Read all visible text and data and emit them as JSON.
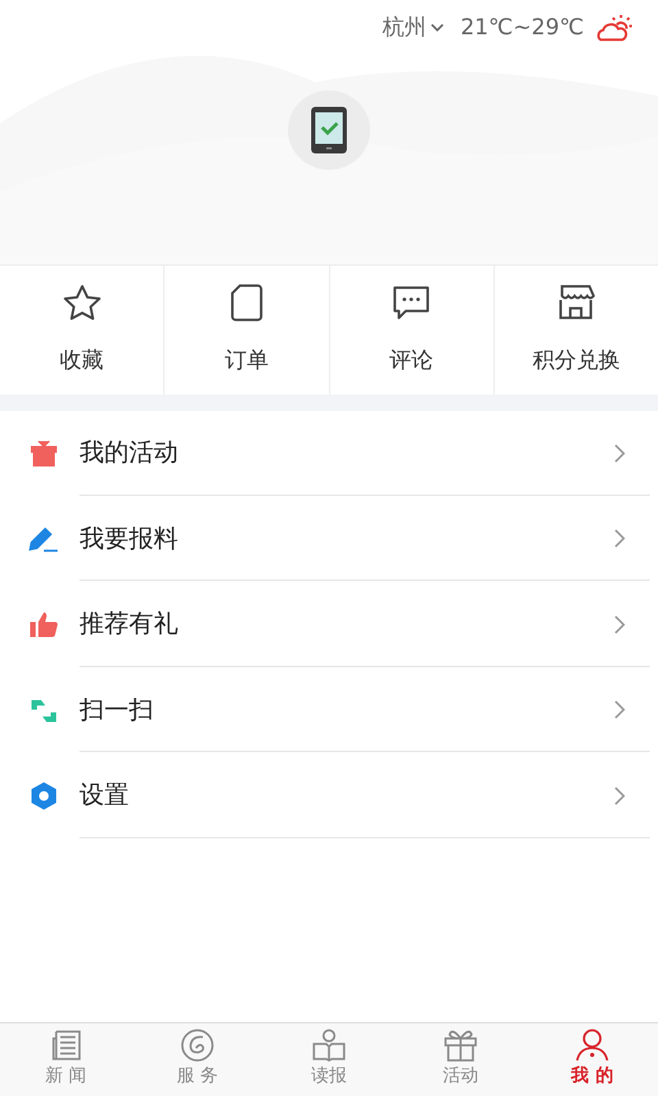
{
  "weather": {
    "city": "杭州",
    "temperature": "21℃~29℃"
  },
  "shortcuts": [
    {
      "label": "收藏"
    },
    {
      "label": "订单"
    },
    {
      "label": "评论"
    },
    {
      "label": "积分兑换"
    }
  ],
  "menu": [
    {
      "label": "我的活动",
      "color": "#f0605c"
    },
    {
      "label": "我要报料",
      "color": "#1d86e3"
    },
    {
      "label": "推荐有礼",
      "color": "#f0605c"
    },
    {
      "label": "扫一扫",
      "color": "#2cc39c"
    },
    {
      "label": "设置",
      "color": "#1d86e3"
    }
  ],
  "tabs": [
    {
      "label": "新 闻",
      "selected": false
    },
    {
      "label": "服 务",
      "selected": false
    },
    {
      "label": "读报",
      "selected": false
    },
    {
      "label": "活动",
      "selected": false
    },
    {
      "label": "我 的",
      "selected": true
    }
  ]
}
